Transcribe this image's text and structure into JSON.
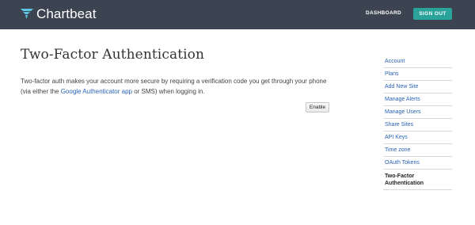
{
  "header": {
    "brand": "Chartbeat",
    "nav_dashboard": "DASHBOARD",
    "sign_out": "SIGN OUT",
    "logo_icon": "chartbeat-logo-icon",
    "accent_color": "#2aa39a",
    "bar_color": "#3d4451"
  },
  "main": {
    "title": "Two-Factor Authentication",
    "intro_before": "Two-factor auth makes your account more secure by requiring a verification code you get through your phone (via either the ",
    "intro_link": "Google Authenticator app",
    "intro_after": " or SMS) when logging in.",
    "enable_button": "Enable"
  },
  "sidebar": {
    "items": [
      {
        "label": "Account"
      },
      {
        "label": "Plans"
      },
      {
        "label": "Add New Site"
      },
      {
        "label": "Manage Alerts"
      },
      {
        "label": "Manage Users"
      },
      {
        "label": "Share Sites"
      },
      {
        "label": "API Keys"
      },
      {
        "label": "Time zone"
      },
      {
        "label": "OAuth Tokens"
      }
    ],
    "current": "Two-Factor Authentication",
    "link_color": "#2a63b5"
  }
}
